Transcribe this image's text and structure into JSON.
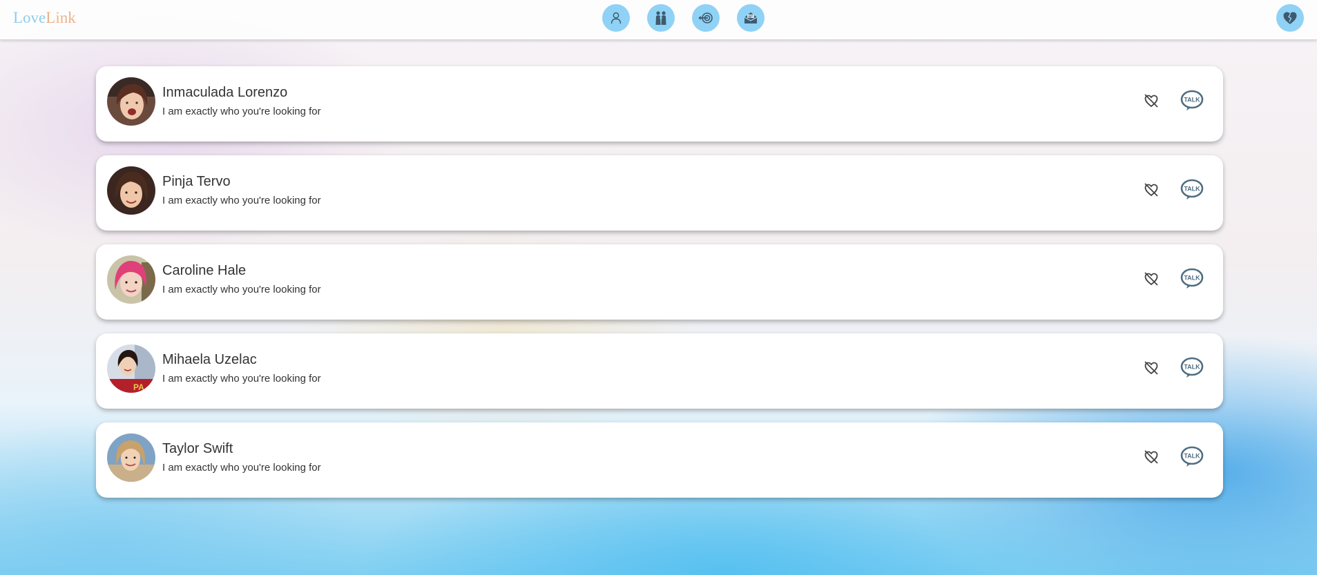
{
  "app": {
    "logo_part1": "Love",
    "logo_part2": "Link"
  },
  "nav": [
    {
      "icon": "person-icon"
    },
    {
      "icon": "couple-icon"
    },
    {
      "icon": "target-icon"
    },
    {
      "icon": "mail-icon"
    }
  ],
  "header_right": {
    "icon": "broken-heart-icon"
  },
  "profiles": [
    {
      "name": "Inmaculada Lorenzo",
      "tagline": "I am exactly who you're looking for"
    },
    {
      "name": "Pinja Tervo",
      "tagline": "I am exactly who you're looking for"
    },
    {
      "name": "Caroline Hale",
      "tagline": "I am exactly who you're looking for"
    },
    {
      "name": "Mihaela Uzelac",
      "tagline": "I am exactly who you're looking for"
    },
    {
      "name": "Taylor Swift",
      "tagline": "I am exactly who you're looking for"
    }
  ],
  "actions": {
    "unlike_icon": "heart-off-icon",
    "talk_icon": "talk-bubble-icon",
    "talk_label": "TALK"
  },
  "colors": {
    "accent": "#8fd2f5",
    "logo_love": "#8fcde9",
    "logo_link": "#e9b38a",
    "icon_dark": "#3f5a6d",
    "talk_icon": "#4f6d80"
  }
}
